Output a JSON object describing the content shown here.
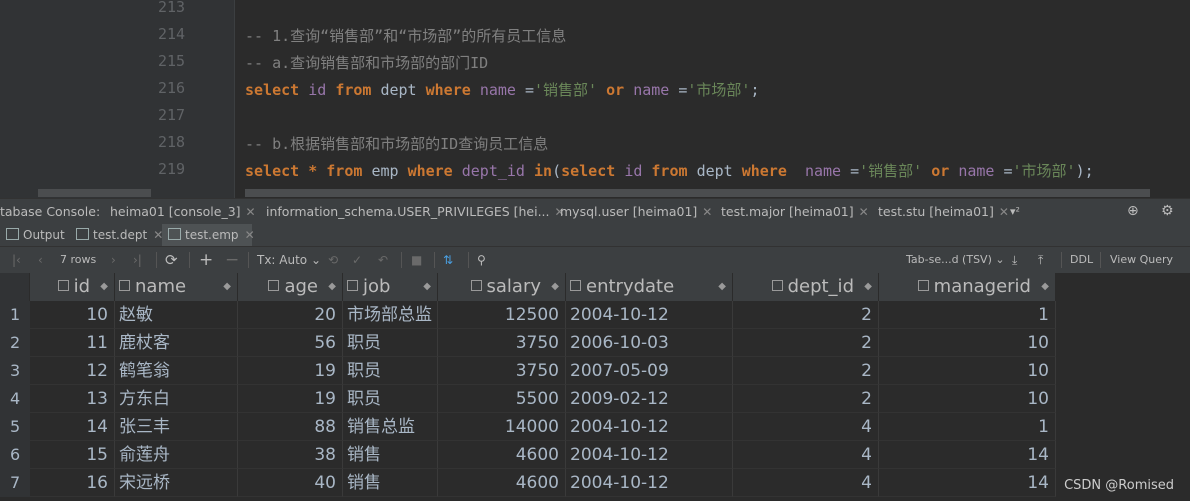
{
  "editor": {
    "line_numbers": [
      "213",
      "214",
      "215",
      "216",
      "217",
      "218",
      "219"
    ],
    "lines": [
      [],
      [
        {
          "t": "cmt",
          "v": "-- 1.查询“销售部”和“市场部”的所有员工信息"
        }
      ],
      [
        {
          "t": "cmt",
          "v": "-- a.查询销售部和市场部的部门ID"
        }
      ],
      [
        {
          "t": "kw",
          "v": "select "
        },
        {
          "t": "col",
          "v": "id "
        },
        {
          "t": "kw",
          "v": "from "
        },
        {
          "t": "plain",
          "v": "dept "
        },
        {
          "t": "kw",
          "v": "where "
        },
        {
          "t": "col",
          "v": "name "
        },
        {
          "t": "plain",
          "v": "="
        },
        {
          "t": "str",
          "v": "'销售部' "
        },
        {
          "t": "kw",
          "v": "or "
        },
        {
          "t": "col",
          "v": "name "
        },
        {
          "t": "plain",
          "v": "="
        },
        {
          "t": "str",
          "v": "'市场部'"
        },
        {
          "t": "plain",
          "v": ";"
        }
      ],
      [],
      [
        {
          "t": "cmt",
          "v": "-- b.根据销售部和市场部的ID查询员工信息"
        }
      ],
      [
        {
          "t": "kw",
          "v": "select "
        },
        {
          "t": "kw",
          "v": "* "
        },
        {
          "t": "kw",
          "v": "from "
        },
        {
          "t": "plain",
          "v": "emp "
        },
        {
          "t": "kw",
          "v": "where "
        },
        {
          "t": "col",
          "v": "dept_id "
        },
        {
          "t": "kw",
          "v": "in"
        },
        {
          "t": "plain",
          "v": "("
        },
        {
          "t": "kw",
          "v": "select "
        },
        {
          "t": "col",
          "v": "id "
        },
        {
          "t": "kw",
          "v": "from "
        },
        {
          "t": "plain",
          "v": "dept "
        },
        {
          "t": "kw",
          "v": "where  "
        },
        {
          "t": "col",
          "v": "name "
        },
        {
          "t": "plain",
          "v": "="
        },
        {
          "t": "str",
          "v": "'销售部' "
        },
        {
          "t": "kw",
          "v": "or "
        },
        {
          "t": "col",
          "v": "name "
        },
        {
          "t": "plain",
          "v": "="
        },
        {
          "t": "str",
          "v": "'市场部'"
        },
        {
          "t": "plain",
          "v": ");"
        }
      ]
    ]
  },
  "console_tabs": [
    {
      "label": "tabase Console:",
      "closable": false
    },
    {
      "label": "heima01 [console_3]",
      "closable": true
    },
    {
      "label": "information_schema.USER_PRIVILEGES [hei...",
      "closable": true
    },
    {
      "label": "mysql.user [heima01]",
      "closable": true
    },
    {
      "label": "test.major [heima01]",
      "closable": true
    },
    {
      "label": "test.stu [heima01]",
      "closable": true
    }
  ],
  "console_overflow": "▾²",
  "result_tabs": [
    {
      "label": "Output",
      "active": false,
      "closable": false
    },
    {
      "label": "test.dept",
      "active": false,
      "closable": true
    },
    {
      "label": "test.emp",
      "active": true,
      "closable": true
    }
  ],
  "toolbar": {
    "rows": "7 rows",
    "tx": "Tx: Auto",
    "format": "Tab-se...d (TSV)",
    "ddl": "DDL",
    "view_query": "View Query"
  },
  "table": {
    "columns": [
      "id",
      "name",
      "age",
      "job",
      "salary",
      "entrydate",
      "dept_id",
      "managerid"
    ],
    "rows": [
      [
        "1",
        "10",
        "赵敏",
        "20",
        "市场部总监",
        "12500",
        "2004-10-12",
        "2",
        "1"
      ],
      [
        "2",
        "11",
        "鹿杖客",
        "56",
        "职员",
        "3750",
        "2006-10-03",
        "2",
        "10"
      ],
      [
        "3",
        "12",
        "鹤笔翁",
        "19",
        "职员",
        "3750",
        "2007-05-09",
        "2",
        "10"
      ],
      [
        "4",
        "13",
        "方东白",
        "19",
        "职员",
        "5500",
        "2009-02-12",
        "2",
        "10"
      ],
      [
        "5",
        "14",
        "张三丰",
        "88",
        "销售总监",
        "14000",
        "2004-10-12",
        "4",
        "1"
      ],
      [
        "6",
        "15",
        "俞莲舟",
        "38",
        "销售",
        "4600",
        "2004-10-12",
        "4",
        "14"
      ],
      [
        "7",
        "16",
        "宋远桥",
        "40",
        "销售",
        "4600",
        "2004-10-12",
        "4",
        "14"
      ]
    ]
  },
  "watermark": "CSDN @Romised"
}
